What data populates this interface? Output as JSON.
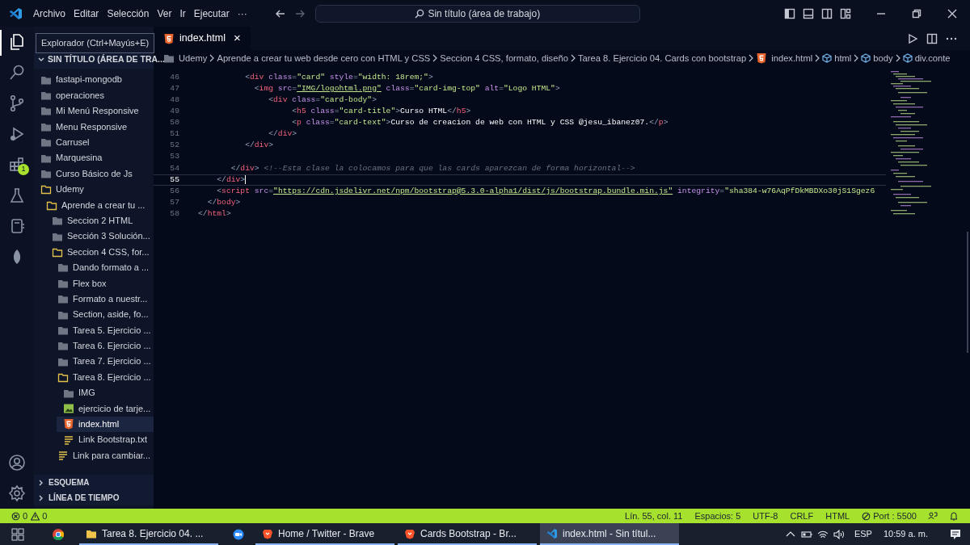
{
  "menu": [
    "Archivo",
    "Editar",
    "Selección",
    "Ver",
    "Ir",
    "Ejecutar",
    "···"
  ],
  "search_box": {
    "text": "Sin título (área de trabajo)"
  },
  "tooltip": "Explorador (Ctrl+Mayús+E)",
  "activity_bar": {
    "extensions_badge": "1"
  },
  "sidebar": {
    "header": "SIN TÍTULO (ÁREA DE TRA...",
    "items": [
      {
        "label": "fastapi-mongodb",
        "kind": "folder",
        "expanded": false,
        "selected": false
      },
      {
        "label": "operaciones",
        "kind": "folder",
        "expanded": false,
        "selected": false
      },
      {
        "label": "Mi Menú Responsive",
        "kind": "folder",
        "expanded": false,
        "selected": false
      },
      {
        "label": "Menu Responsive",
        "kind": "folder",
        "expanded": false,
        "selected": false
      },
      {
        "label": "Carrusel",
        "kind": "folder",
        "expanded": false,
        "selected": false
      },
      {
        "label": "Marquesina",
        "kind": "folder",
        "expanded": false,
        "selected": false
      },
      {
        "label": "Curso Básico de Js",
        "kind": "folder",
        "expanded": false,
        "selected": false
      },
      {
        "label": "Udemy",
        "kind": "folder",
        "expanded": true,
        "selected": false,
        "children": [
          {
            "label": "Aprende a crear tu ...",
            "kind": "folder",
            "expanded": true,
            "selected": false,
            "children": [
              {
                "label": "Seccion 2 HTML",
                "kind": "folder",
                "expanded": false,
                "selected": false
              },
              {
                "label": "Sección 3 Solución...",
                "kind": "folder",
                "expanded": false,
                "selected": false
              },
              {
                "label": "Seccion 4 CSS, for...",
                "kind": "folder",
                "expanded": true,
                "selected": false,
                "children": [
                  {
                    "label": "Dando formato a ...",
                    "kind": "folder",
                    "expanded": false,
                    "selected": false
                  },
                  {
                    "label": "Flex box",
                    "kind": "folder",
                    "expanded": false,
                    "selected": false
                  },
                  {
                    "label": "Formato a nuestr...",
                    "kind": "folder",
                    "expanded": false,
                    "selected": false
                  },
                  {
                    "label": "Section, aside, fo...",
                    "kind": "folder",
                    "expanded": false,
                    "selected": false
                  },
                  {
                    "label": "Tarea 5. Ejercicio ...",
                    "kind": "folder",
                    "expanded": false,
                    "selected": false
                  },
                  {
                    "label": "Tarea 6. Ejercicio ...",
                    "kind": "folder",
                    "expanded": false,
                    "selected": false
                  },
                  {
                    "label": "Tarea 7. Ejercicio ...",
                    "kind": "folder",
                    "expanded": false,
                    "selected": false
                  },
                  {
                    "label": "Tarea 8. Ejercicio ...",
                    "kind": "folder",
                    "expanded": true,
                    "selected": false,
                    "children": [
                      {
                        "label": "IMG",
                        "kind": "folder",
                        "expanded": false,
                        "selected": false
                      },
                      {
                        "label": "ejercicio de tarje...",
                        "kind": "image",
                        "selected": false
                      },
                      {
                        "label": "index.html",
                        "kind": "html",
                        "selected": true
                      },
                      {
                        "label": "Link Bootstrap.txt",
                        "kind": "text",
                        "selected": false
                      }
                    ]
                  },
                  {
                    "label": "Link para cambiar...",
                    "kind": "text",
                    "selected": false
                  }
                ]
              }
            ]
          }
        ]
      }
    ],
    "sections": [
      {
        "label": "ESQUEMA",
        "expanded": false
      },
      {
        "label": "LÍNEA DE TIEMPO",
        "expanded": false
      }
    ]
  },
  "tab": {
    "label": "index.html",
    "close": "×"
  },
  "breadcrumbs": [
    {
      "kind": "folder",
      "label": "Udemy"
    },
    {
      "kind": "plain",
      "label": "Aprende a crear tu web desde cero con HTML y CSS"
    },
    {
      "kind": "plain",
      "label": "Seccion 4 CSS, formato, diseño"
    },
    {
      "kind": "plain",
      "label": "Tarea 8. Ejercicio 04. Cards con bootstrap"
    },
    {
      "kind": "html",
      "label": "index.html"
    },
    {
      "kind": "symbol",
      "label": "html"
    },
    {
      "kind": "symbol",
      "label": "body"
    },
    {
      "kind": "symbol",
      "label": "div.conte"
    }
  ],
  "code": [
    {
      "number": "46",
      "current": false,
      "tokens": [
        {
          "kind": "punct",
          "text": "          <"
        },
        {
          "kind": "tag",
          "text": "div"
        },
        {
          "kind": "attr",
          "text": " class"
        },
        {
          "kind": "punct",
          "text": "="
        },
        {
          "kind": "string",
          "text": "\"card\""
        },
        {
          "kind": "attr",
          "text": " style"
        },
        {
          "kind": "punct",
          "text": "="
        },
        {
          "kind": "string",
          "text": "\"width: 18rem;\""
        },
        {
          "kind": "punct",
          "text": ">"
        }
      ]
    },
    {
      "number": "47",
      "current": false,
      "tokens": [
        {
          "kind": "punct",
          "text": "            <"
        },
        {
          "kind": "tag",
          "text": "img"
        },
        {
          "kind": "attr",
          "text": " src"
        },
        {
          "kind": "punct",
          "text": "="
        },
        {
          "kind": "link",
          "text": "\"IMG/logohtml.png\""
        },
        {
          "kind": "attr",
          "text": " class"
        },
        {
          "kind": "punct",
          "text": "="
        },
        {
          "kind": "string",
          "text": "\"card-img-top\""
        },
        {
          "kind": "attr",
          "text": " alt"
        },
        {
          "kind": "punct",
          "text": "="
        },
        {
          "kind": "string",
          "text": "\"Logo HTML\""
        },
        {
          "kind": "punct",
          "text": ">"
        }
      ]
    },
    {
      "number": "48",
      "current": false,
      "tokens": [
        {
          "kind": "punct",
          "text": "               <"
        },
        {
          "kind": "tag",
          "text": "div"
        },
        {
          "kind": "attr",
          "text": " class"
        },
        {
          "kind": "punct",
          "text": "="
        },
        {
          "kind": "string",
          "text": "\"card-body\""
        },
        {
          "kind": "punct",
          "text": ">"
        }
      ]
    },
    {
      "number": "49",
      "current": false,
      "tokens": [
        {
          "kind": "punct",
          "text": "                    <"
        },
        {
          "kind": "tag",
          "text": "h5"
        },
        {
          "kind": "attr",
          "text": " class"
        },
        {
          "kind": "punct",
          "text": "="
        },
        {
          "kind": "string",
          "text": "\"card-title\""
        },
        {
          "kind": "punct",
          "text": ">"
        },
        {
          "kind": "text",
          "text": "Curso HTML"
        },
        {
          "kind": "punct",
          "text": "</"
        },
        {
          "kind": "tag",
          "text": "h5"
        },
        {
          "kind": "punct",
          "text": ">"
        }
      ]
    },
    {
      "number": "50",
      "current": false,
      "tokens": [
        {
          "kind": "punct",
          "text": "                    <"
        },
        {
          "kind": "tag",
          "text": "p"
        },
        {
          "kind": "attr",
          "text": " class"
        },
        {
          "kind": "punct",
          "text": "="
        },
        {
          "kind": "string",
          "text": "\"card-text\""
        },
        {
          "kind": "punct",
          "text": ">"
        },
        {
          "kind": "text",
          "text": "Curso de creacion de web con HTML y CSS @jesu_ibanez07."
        },
        {
          "kind": "punct",
          "text": "</"
        },
        {
          "kind": "tag",
          "text": "p"
        },
        {
          "kind": "punct",
          "text": ">"
        }
      ]
    },
    {
      "number": "51",
      "current": false,
      "tokens": [
        {
          "kind": "punct",
          "text": "               </"
        },
        {
          "kind": "tag",
          "text": "div"
        },
        {
          "kind": "punct",
          "text": ">"
        }
      ]
    },
    {
      "number": "52",
      "current": false,
      "tokens": [
        {
          "kind": "punct",
          "text": "          </"
        },
        {
          "kind": "tag",
          "text": "div"
        },
        {
          "kind": "punct",
          "text": ">"
        }
      ]
    },
    {
      "number": "53",
      "current": false
    },
    {
      "number": "54",
      "current": false,
      "tokens": [
        {
          "kind": "punct",
          "text": "       </"
        },
        {
          "kind": "tag",
          "text": "div"
        },
        {
          "kind": "punct",
          "text": "> "
        },
        {
          "kind": "comment",
          "text": "<!--Esta clase la colocamos para que las cards aparezcan de forma horizontal-->"
        }
      ]
    },
    {
      "number": "55",
      "current": true,
      "tokens": [
        {
          "kind": "punct",
          "text": "    </"
        },
        {
          "kind": "tag",
          "text": "div"
        },
        {
          "kind": "punct",
          "text": ">"
        }
      ]
    },
    {
      "number": "56",
      "current": false,
      "tokens": [
        {
          "kind": "punct",
          "text": "    <"
        },
        {
          "kind": "tag",
          "text": "script"
        },
        {
          "kind": "attr",
          "text": " src"
        },
        {
          "kind": "punct",
          "text": "="
        },
        {
          "kind": "link",
          "text": "\"https://cdn.jsdelivr.net/npm/bootstrap@5.3.0-alpha1/dist/js/bootstrap.bundle.min.js\""
        },
        {
          "kind": "attr",
          "text": " integrity"
        },
        {
          "kind": "punct",
          "text": "="
        },
        {
          "kind": "string",
          "text": "\"sha384-w76AqPfDkMBDXo30jS1Sgez6"
        }
      ]
    },
    {
      "number": "57",
      "current": false,
      "tokens": [
        {
          "kind": "punct",
          "text": "  </"
        },
        {
          "kind": "tag",
          "text": "body"
        },
        {
          "kind": "punct",
          "text": ">"
        }
      ]
    },
    {
      "number": "58",
      "current": false,
      "tokens": [
        {
          "kind": "punct",
          "text": "</"
        },
        {
          "kind": "tag",
          "text": "html"
        },
        {
          "kind": "punct",
          "text": ">"
        }
      ]
    }
  ],
  "status_bar": {
    "errors": "0",
    "warnings": "0",
    "items": [
      "Lín. 55, col. 11",
      "Espacios: 5",
      "UTF-8",
      "CRLF",
      "HTML"
    ],
    "port": "Port : 5500"
  },
  "taskbar": {
    "items": [
      {
        "kind": "folder",
        "label": "Tarea 8. Ejercicio 04. ...",
        "selected": false
      },
      {
        "kind": "zoom"
      },
      {
        "kind": "brave",
        "label": "Home / Twitter - Brave",
        "selected": false
      },
      {
        "kind": "brave",
        "label": "Cards Bootstrap - Br...",
        "selected": false
      },
      {
        "kind": "vscode",
        "label": "index.html - Sin títul...",
        "selected": true
      }
    ],
    "language": "ESP",
    "time": "10:59 a. m."
  }
}
